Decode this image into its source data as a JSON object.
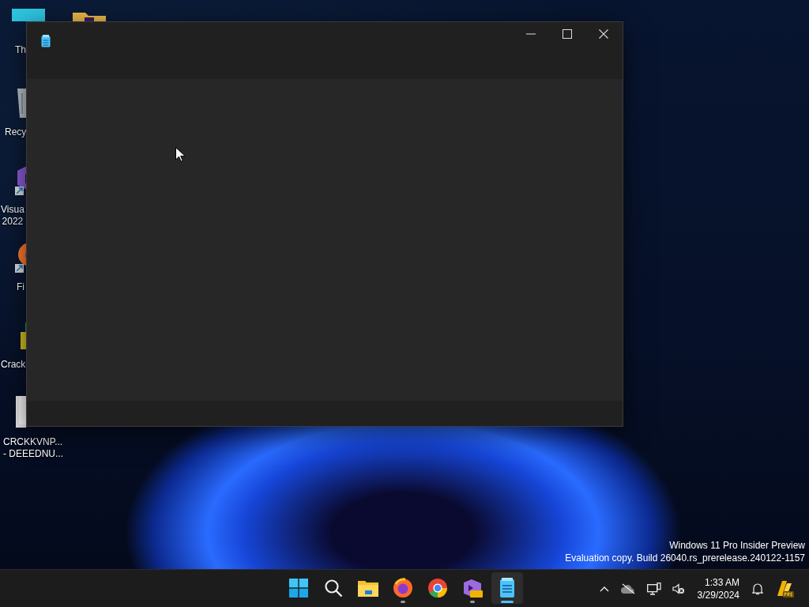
{
  "desktop": {
    "icons": [
      {
        "kind": "monitor",
        "label_lines": [
          "Th"
        ]
      },
      {
        "kind": "folder"
      },
      {
        "kind": "recycle",
        "label_lines": [
          "Recy"
        ]
      },
      {
        "kind": "vs",
        "label_lines": [
          "Visua",
          "2022"
        ]
      },
      {
        "kind": "firefox",
        "label_lines": [
          "Fi"
        ]
      },
      {
        "kind": "crack",
        "label_lines": [
          "Crack"
        ]
      },
      {
        "kind": "file",
        "label_lines": [
          "CRCKKVNP...",
          "- DEEEDNU..."
        ]
      }
    ],
    "watermark": [
      "Windows 11 Pro Insider Preview",
      "Evaluation copy. Build 26040.rs_prerelease.240122-1157"
    ]
  },
  "taskbar": {
    "apps": [
      {
        "kind": "start",
        "running": false,
        "selected": false
      },
      {
        "kind": "search",
        "running": false,
        "selected": false
      },
      {
        "kind": "explorer",
        "running": false,
        "selected": false
      },
      {
        "kind": "firefox",
        "running": true,
        "selected": false
      },
      {
        "kind": "chrome",
        "running": false,
        "selected": false
      },
      {
        "kind": "vs",
        "running": true,
        "selected": false
      },
      {
        "kind": "notepad",
        "running": true,
        "selected": true
      }
    ],
    "tray": {
      "time": "1:33 AM",
      "date": "3/29/2024"
    }
  }
}
